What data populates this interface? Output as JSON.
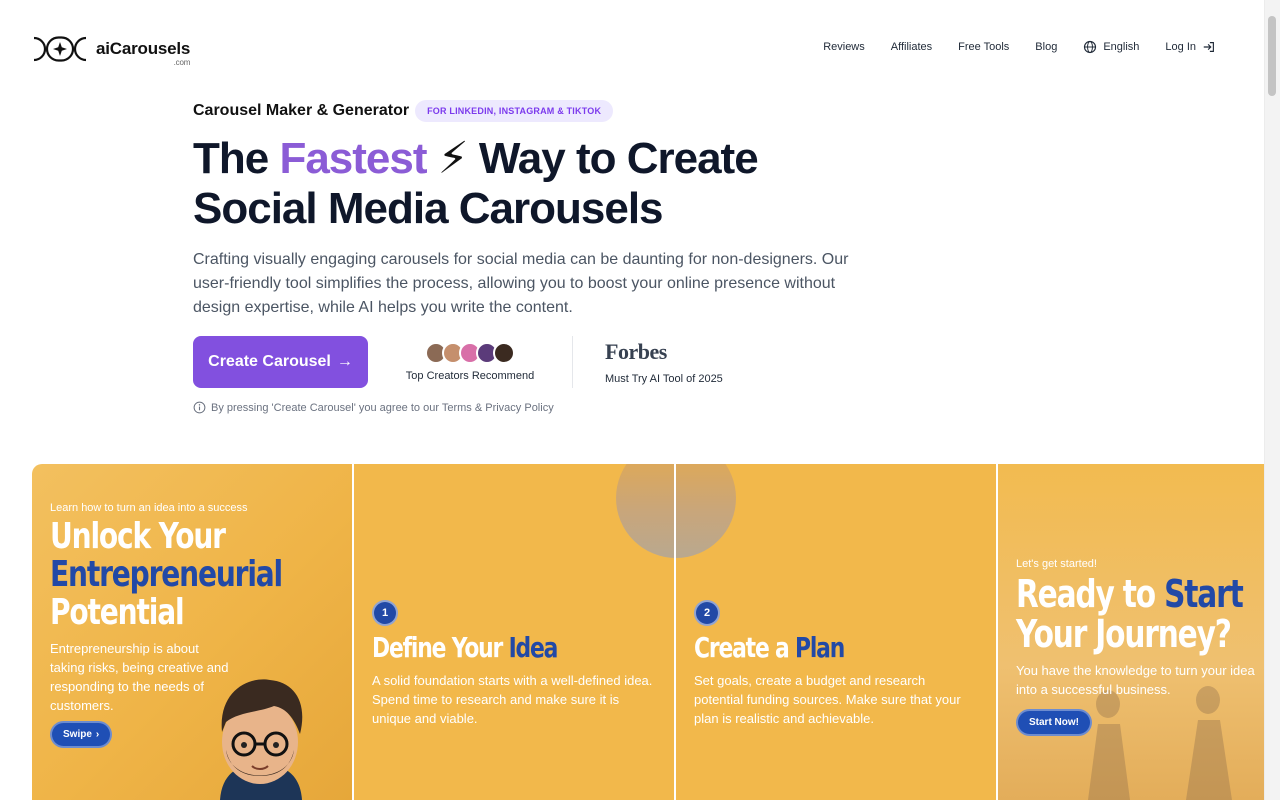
{
  "header": {
    "brand": "aiCarousels",
    "brand_suffix": ".com",
    "nav": {
      "reviews": "Reviews",
      "affiliates": "Affiliates",
      "free_tools": "Free Tools",
      "blog": "Blog",
      "language": "English",
      "login": "Log In"
    }
  },
  "hero": {
    "eyebrow_title": "Carousel Maker & Generator",
    "eyebrow_badge": "FOR LINKEDIN, INSTAGRAM & TIKTOK",
    "headline_part1": "The ",
    "headline_accent": "Fastest",
    "headline_bolt": "⚡",
    "headline_part2": " Way to Create",
    "headline_line2": "Social Media Carousels",
    "lead": "Crafting visually engaging carousels for social media can be daunting for non-designers. Our user-friendly tool simplifies the process, allowing you to boost your online presence without design expertise, while AI helps you write the content.",
    "cta_label": "Create Carousel",
    "cta_arrow": "→",
    "proof_label": "Top Creators Recommend",
    "forbes_logo": "Forbes",
    "forbes_label": "Must Try AI Tool of 2025",
    "disclaimer": "By pressing 'Create Carousel' you agree to our Terms & Privacy Policy"
  },
  "avatars": [
    "#8b6a55",
    "#c58f6d",
    "#d86fa8",
    "#5b3b7a",
    "#3b2a20"
  ],
  "slides": {
    "s1": {
      "kicker": "Learn how to turn an idea into a success",
      "head_line1": "Unlock Your",
      "head_line2": "Entrepreneurial",
      "head_line3": "Potential",
      "body": "Entrepreneurship is about taking risks, being creative and responding to the needs of customers.",
      "button": "Swipe",
      "button_icon": "›"
    },
    "s2": {
      "step": "1",
      "head_white": "Define Your ",
      "head_blue": "Idea",
      "body": "A solid foundation starts with a well-defined idea. Spend time to research and make sure it is unique and viable."
    },
    "s3": {
      "step": "2",
      "head_white": "Create a ",
      "head_blue": "Plan",
      "body": "Set goals, create a budget and research potential funding sources. Make sure that your plan is realistic and achievable."
    },
    "s4": {
      "kicker": "Let's get started!",
      "head_white1": "Ready to ",
      "head_blue1": "Start",
      "head_line2": "Your Journey?",
      "body": "You have the knowledge to turn your idea into a successful business.",
      "button": "Start Now!"
    }
  },
  "colors": {
    "brand_purple": "#8250df",
    "accent_purple": "#8b5cd6",
    "slide_yellow": "#f2b84b",
    "slide_blue": "#2249a6"
  }
}
